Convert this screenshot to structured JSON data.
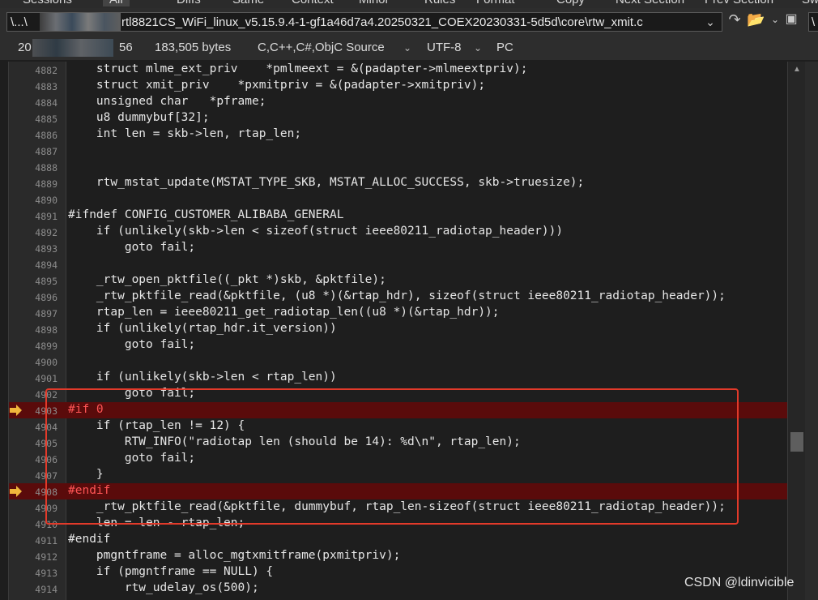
{
  "tabs": [
    {
      "label": "Sessions",
      "active": false
    },
    {
      "label": "All",
      "active": true
    },
    {
      "label": "Diffs",
      "active": false
    },
    {
      "label": "Same",
      "active": false
    },
    {
      "label": "Context",
      "active": false
    },
    {
      "label": "Minor",
      "active": false
    },
    {
      "label": "Rules",
      "active": false
    },
    {
      "label": "Format",
      "active": false
    },
    {
      "label": "Copy",
      "active": false
    },
    {
      "label": "Next Section",
      "active": false
    },
    {
      "label": "Prev Section",
      "active": false
    },
    {
      "label": "Sw",
      "active": false
    }
  ],
  "pathbar": {
    "left_prefix": "\\...\\",
    "left_path": "rtl8821CS_WiFi_linux_v5.15.9.4-1-gf1a46d7a4.20250321_COEX20230331-5d5d\\core\\rtw_xmit.c",
    "right_path": "\\"
  },
  "status": {
    "date_prefix": "20",
    "time_suffix": "56",
    "size": "183,505 bytes",
    "language": "C,C++,C#,ObjC Source",
    "encoding": "UTF-8",
    "line_ending": "PC"
  },
  "icons": {
    "dropdown": "chevron-down-icon",
    "next": "arrow-return-icon",
    "folder": "folder-open-icon",
    "save": "save-icon",
    "bookmark": "bookmark-arrow-icon"
  },
  "colors": {
    "preprocessor": "#ff5555",
    "highlight_line": "#5a0b0b",
    "annotation": "#e23a2a",
    "bookmark": "#f0b73c"
  },
  "lines": [
    {
      "n": "4882",
      "text": "    struct mlme_ext_priv    *pmlmeext = &(padapter->mlmeextpriv);",
      "pp": false,
      "hl": false,
      "mark": false
    },
    {
      "n": "4883",
      "text": "    struct xmit_priv    *pxmitpriv = &(padapter->xmitpriv);",
      "pp": false,
      "hl": false,
      "mark": false
    },
    {
      "n": "4884",
      "text": "    unsigned char   *pframe;",
      "pp": false,
      "hl": false,
      "mark": false
    },
    {
      "n": "4885",
      "text": "    u8 dummybuf[32];",
      "pp": false,
      "hl": false,
      "mark": false
    },
    {
      "n": "4886",
      "text": "    int len = skb->len, rtap_len;",
      "pp": false,
      "hl": false,
      "mark": false
    },
    {
      "n": "4887",
      "text": "",
      "pp": false,
      "hl": false,
      "mark": false
    },
    {
      "n": "4888",
      "text": "",
      "pp": false,
      "hl": false,
      "mark": false
    },
    {
      "n": "4889",
      "text": "    rtw_mstat_update(MSTAT_TYPE_SKB, MSTAT_ALLOC_SUCCESS, skb->truesize);",
      "pp": false,
      "hl": false,
      "mark": false
    },
    {
      "n": "4890",
      "text": "",
      "pp": false,
      "hl": false,
      "mark": false
    },
    {
      "n": "4891",
      "text": "#ifndef CONFIG_CUSTOMER_ALIBABA_GENERAL",
      "pp": false,
      "hl": false,
      "mark": false
    },
    {
      "n": "4892",
      "text": "    if (unlikely(skb->len < sizeof(struct ieee80211_radiotap_header)))",
      "pp": false,
      "hl": false,
      "mark": false
    },
    {
      "n": "4893",
      "text": "        goto fail;",
      "pp": false,
      "hl": false,
      "mark": false
    },
    {
      "n": "4894",
      "text": "",
      "pp": false,
      "hl": false,
      "mark": false
    },
    {
      "n": "4895",
      "text": "    _rtw_open_pktfile((_pkt *)skb, &pktfile);",
      "pp": false,
      "hl": false,
      "mark": false
    },
    {
      "n": "4896",
      "text": "    _rtw_pktfile_read(&pktfile, (u8 *)(&rtap_hdr), sizeof(struct ieee80211_radiotap_header));",
      "pp": false,
      "hl": false,
      "mark": false
    },
    {
      "n": "4897",
      "text": "    rtap_len = ieee80211_get_radiotap_len((u8 *)(&rtap_hdr));",
      "pp": false,
      "hl": false,
      "mark": false
    },
    {
      "n": "4898",
      "text": "    if (unlikely(rtap_hdr.it_version))",
      "pp": false,
      "hl": false,
      "mark": false
    },
    {
      "n": "4899",
      "text": "        goto fail;",
      "pp": false,
      "hl": false,
      "mark": false
    },
    {
      "n": "4900",
      "text": "",
      "pp": false,
      "hl": false,
      "mark": false
    },
    {
      "n": "4901",
      "text": "    if (unlikely(skb->len < rtap_len))",
      "pp": false,
      "hl": false,
      "mark": false
    },
    {
      "n": "4902",
      "text": "        goto fail;",
      "pp": false,
      "hl": false,
      "mark": false
    },
    {
      "n": "4903",
      "text": "#if 0",
      "pp": true,
      "hl": true,
      "mark": true
    },
    {
      "n": "4904",
      "text": "    if (rtap_len != 12) {",
      "pp": false,
      "hl": false,
      "mark": false
    },
    {
      "n": "4905",
      "text": "        RTW_INFO(\"radiotap len (should be 14): %d\\n\", rtap_len);",
      "pp": false,
      "hl": false,
      "mark": false
    },
    {
      "n": "4906",
      "text": "        goto fail;",
      "pp": false,
      "hl": false,
      "mark": false
    },
    {
      "n": "4907",
      "text": "    }",
      "pp": false,
      "hl": false,
      "mark": false
    },
    {
      "n": "4908",
      "text": "#endif",
      "pp": true,
      "hl": true,
      "mark": true
    },
    {
      "n": "4909",
      "text": "    _rtw_pktfile_read(&pktfile, dummybuf, rtap_len-sizeof(struct ieee80211_radiotap_header));",
      "pp": false,
      "hl": false,
      "mark": false
    },
    {
      "n": "4910",
      "text": "    len = len - rtap_len;",
      "pp": false,
      "hl": false,
      "mark": false
    },
    {
      "n": "4911",
      "text": "#endif",
      "pp": false,
      "hl": false,
      "mark": false
    },
    {
      "n": "4912",
      "text": "    pmgntframe = alloc_mgtxmitframe(pxmitpriv);",
      "pp": false,
      "hl": false,
      "mark": false
    },
    {
      "n": "4913",
      "text": "    if (pmgntframe == NULL) {",
      "pp": false,
      "hl": false,
      "mark": false
    },
    {
      "n": "4914",
      "text": "        rtw_udelay_os(500);",
      "pp": false,
      "hl": false,
      "mark": false
    }
  ],
  "watermark": "CSDN @ldinvicible"
}
